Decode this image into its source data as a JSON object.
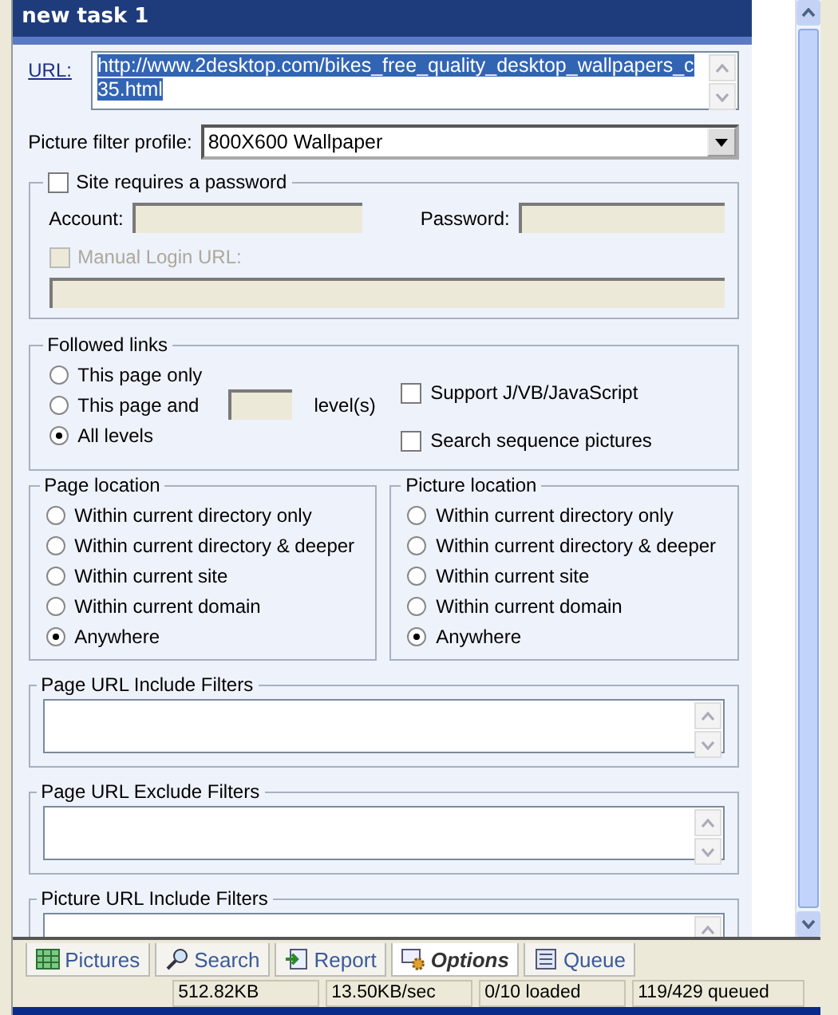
{
  "window": {
    "title": "new task 1"
  },
  "url": {
    "label": "URL:",
    "value": "http://www.2desktop.com/bikes_free_quality_desktop_wallpapers_c35.html"
  },
  "filter_profile": {
    "label": "Picture filter profile:",
    "value": "800X600 Wallpaper"
  },
  "password_group": {
    "label": "Site requires a password",
    "checked": false,
    "account_label": "Account:",
    "password_label": "Password:",
    "manual_login": {
      "label": "Manual Login URL:",
      "checked": false,
      "disabled": true
    }
  },
  "followed_links": {
    "title": "Followed links",
    "options": [
      {
        "label": "This page only",
        "selected": false
      },
      {
        "label": "This page and",
        "selected": false,
        "suffix": "level(s)"
      },
      {
        "label": "All levels",
        "selected": true
      }
    ],
    "checkboxes": [
      {
        "label": "Support J/VB/JavaScript",
        "checked": false
      },
      {
        "label": "Search sequence pictures",
        "checked": false
      }
    ]
  },
  "locations": [
    {
      "title": "Page location",
      "options": [
        {
          "label": "Within current directory only",
          "selected": false
        },
        {
          "label": "Within current directory & deeper",
          "selected": false
        },
        {
          "label": "Within current site",
          "selected": false
        },
        {
          "label": "Within current domain",
          "selected": false
        },
        {
          "label": "Anywhere",
          "selected": true
        }
      ]
    },
    {
      "title": "Picture location",
      "options": [
        {
          "label": "Within current directory only",
          "selected": false
        },
        {
          "label": "Within current directory & deeper",
          "selected": false
        },
        {
          "label": "Within current site",
          "selected": false
        },
        {
          "label": "Within current domain",
          "selected": false
        },
        {
          "label": "Anywhere",
          "selected": true
        }
      ]
    }
  ],
  "filters": [
    {
      "title": "Page URL Include Filters"
    },
    {
      "title": "Page URL Exclude Filters"
    },
    {
      "title": "Picture URL Include Filters"
    }
  ],
  "tabs": [
    {
      "label": "Pictures",
      "selected": false,
      "kind": "grid"
    },
    {
      "label": "Search",
      "selected": false,
      "kind": "search"
    },
    {
      "label": "Report",
      "selected": false,
      "kind": "report"
    },
    {
      "label": "Options",
      "selected": true,
      "kind": "gear"
    },
    {
      "label": "Queue",
      "selected": false,
      "kind": "queue"
    }
  ],
  "status_bar": [
    "512.82KB",
    "13.50KB/sec",
    "0/10 loaded",
    "119/429 queued"
  ]
}
